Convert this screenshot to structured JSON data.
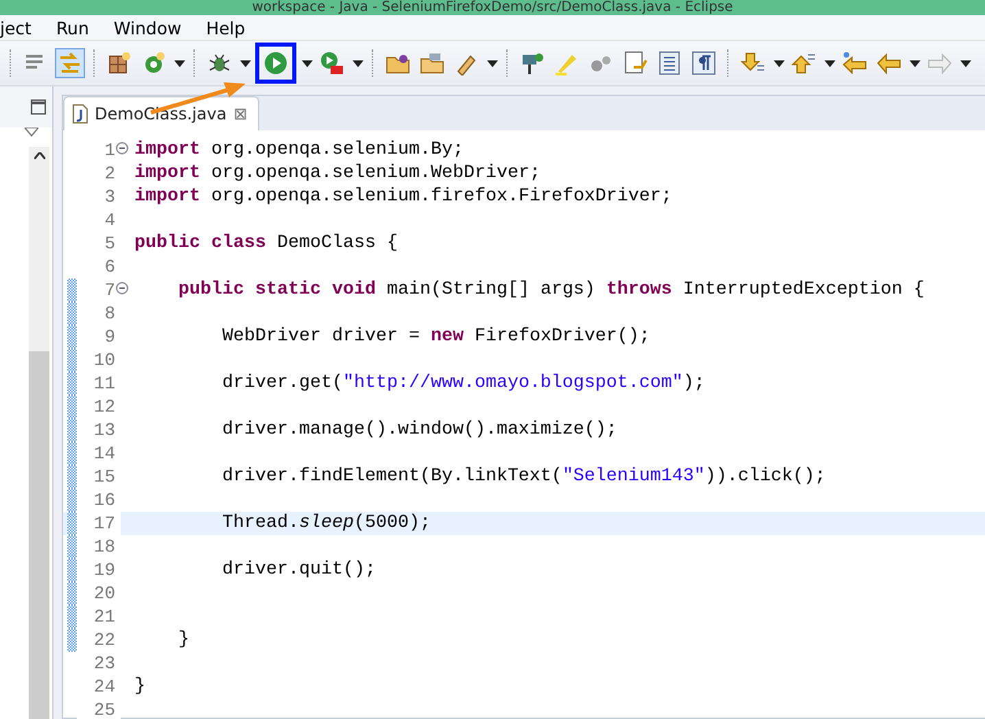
{
  "window": {
    "title": "workspace - Java - SeleniumFirefoxDemo/src/DemoClass.java - Eclipse"
  },
  "menu": [
    "ject",
    "Run",
    "Window",
    "Help"
  ],
  "toolbar": [
    {
      "kind": "sep"
    },
    {
      "kind": "lines",
      "pressed": false,
      "highlighted": false
    },
    {
      "kind": "link",
      "pressed": true,
      "highlighted": false
    },
    {
      "kind": "sep"
    },
    {
      "kind": "grid",
      "pressed": false,
      "highlighted": false
    },
    {
      "kind": "refresh",
      "pressed": false,
      "highlighted": false,
      "dropdown": true
    },
    {
      "kind": "sep"
    },
    {
      "kind": "bug",
      "pressed": false,
      "highlighted": false,
      "dropdown": true
    },
    {
      "kind": "run",
      "pressed": false,
      "highlighted": true,
      "dropdown": true
    },
    {
      "kind": "runtool",
      "pressed": false,
      "highlighted": false,
      "dropdown": true
    },
    {
      "kind": "sep"
    },
    {
      "kind": "folder",
      "pressed": false,
      "highlighted": false
    },
    {
      "kind": "openfolder",
      "pressed": false,
      "highlighted": false
    },
    {
      "kind": "pen",
      "pressed": false,
      "highlighted": false,
      "dropdown": true
    },
    {
      "kind": "sep"
    },
    {
      "kind": "search",
      "pressed": false,
      "highlighted": false
    },
    {
      "kind": "marker",
      "pressed": false,
      "highlighted": false
    },
    {
      "kind": "dots",
      "pressed": false,
      "highlighted": false
    },
    {
      "kind": "doc",
      "pressed": false,
      "highlighted": false
    },
    {
      "kind": "list",
      "pressed": false,
      "highlighted": false
    },
    {
      "kind": "para",
      "pressed": false,
      "highlighted": false
    },
    {
      "kind": "sep"
    },
    {
      "kind": "down",
      "pressed": false,
      "highlighted": false,
      "dropdown": true
    },
    {
      "kind": "up",
      "pressed": false,
      "highlighted": false,
      "dropdown": true
    },
    {
      "kind": "backstar",
      "pressed": false,
      "highlighted": false
    },
    {
      "kind": "back",
      "pressed": false,
      "highlighted": false,
      "dropdown": true
    },
    {
      "kind": "forward",
      "pressed": false,
      "highlighted": false,
      "dropdown": true
    }
  ],
  "editor": {
    "tab": {
      "label": "DemoClass.java",
      "selected": true,
      "close": "⊠"
    },
    "lines": [
      {
        "number": "1",
        "fold": true,
        "changed": false,
        "current": false,
        "tokens": [
          {
            "kind": "kw",
            "text": "import"
          },
          {
            "kind": "plain",
            "text": " org.openqa.selenium.By;"
          }
        ]
      },
      {
        "number": "2",
        "fold": false,
        "changed": false,
        "current": false,
        "tokens": [
          {
            "kind": "kw",
            "text": "import"
          },
          {
            "kind": "plain",
            "text": " org.openqa.selenium.WebDriver;"
          }
        ]
      },
      {
        "number": "3",
        "fold": false,
        "changed": false,
        "current": false,
        "tokens": [
          {
            "kind": "kw",
            "text": "import"
          },
          {
            "kind": "plain",
            "text": " org.openqa.selenium.firefox.FirefoxDriver;"
          }
        ]
      },
      {
        "number": "4",
        "fold": false,
        "changed": false,
        "current": false
      },
      {
        "number": "5",
        "fold": false,
        "changed": false,
        "current": false,
        "tokens": [
          {
            "kind": "kw",
            "text": "public class"
          },
          {
            "kind": "plain",
            "text": " DemoClass {"
          }
        ]
      },
      {
        "number": "6",
        "fold": false,
        "changed": false,
        "current": false
      },
      {
        "number": "7",
        "fold": true,
        "changed": true,
        "current": false,
        "tokens": [
          {
            "kind": "kw",
            "text": "    public static void"
          },
          {
            "kind": "plain",
            "text": " main(String[] args) "
          },
          {
            "kind": "kw",
            "text": "throws"
          },
          {
            "kind": "plain",
            "text": " InterruptedException {"
          }
        ]
      },
      {
        "number": "8",
        "fold": false,
        "changed": true,
        "current": false
      },
      {
        "number": "9",
        "fold": false,
        "changed": true,
        "current": false,
        "tokens": [
          {
            "kind": "plain",
            "text": "        WebDriver driver = "
          },
          {
            "kind": "kw",
            "text": "new"
          },
          {
            "kind": "plain",
            "text": " FirefoxDriver();"
          }
        ]
      },
      {
        "number": "10",
        "fold": false,
        "changed": true,
        "current": false
      },
      {
        "number": "11",
        "fold": false,
        "changed": true,
        "current": false,
        "tokens": [
          {
            "kind": "plain",
            "text": "        driver.get("
          },
          {
            "kind": "str",
            "text": "\"http://www.omayo.blogspot.com\""
          },
          {
            "kind": "plain",
            "text": ");"
          }
        ]
      },
      {
        "number": "12",
        "fold": false,
        "changed": true,
        "current": false
      },
      {
        "number": "13",
        "fold": false,
        "changed": true,
        "current": false,
        "tokens": [
          {
            "kind": "plain",
            "text": "        driver.manage().window().maximize();"
          }
        ]
      },
      {
        "number": "14",
        "fold": false,
        "changed": true,
        "current": false
      },
      {
        "number": "15",
        "fold": false,
        "changed": true,
        "current": false,
        "tokens": [
          {
            "kind": "plain",
            "text": "        driver.findElement(By.linkText("
          },
          {
            "kind": "str",
            "text": "\"Selenium143\""
          },
          {
            "kind": "plain",
            "text": ")).click();"
          }
        ]
      },
      {
        "number": "16",
        "fold": false,
        "changed": true,
        "current": false
      },
      {
        "number": "17",
        "fold": false,
        "changed": true,
        "current": true,
        "tokens": [
          {
            "kind": "plain",
            "text": "        Thread."
          },
          {
            "kind": "italic",
            "text": "sleep"
          },
          {
            "kind": "plain",
            "text": "(5000);"
          }
        ]
      },
      {
        "number": "18",
        "fold": false,
        "changed": true,
        "current": false
      },
      {
        "number": "19",
        "fold": false,
        "changed": true,
        "current": false,
        "tokens": [
          {
            "kind": "plain",
            "text": "        driver.quit();"
          }
        ]
      },
      {
        "number": "20",
        "fold": false,
        "changed": true,
        "current": false
      },
      {
        "number": "21",
        "fold": false,
        "changed": true,
        "current": false
      },
      {
        "number": "22",
        "fold": false,
        "changed": true,
        "current": false,
        "tokens": [
          {
            "kind": "plain",
            "text": "    }"
          }
        ]
      },
      {
        "number": "23",
        "fold": false,
        "changed": false,
        "current": false
      },
      {
        "number": "24",
        "fold": false,
        "changed": false,
        "current": false,
        "tokens": [
          {
            "kind": "plain",
            "text": "}"
          }
        ]
      },
      {
        "number": "25",
        "fold": false,
        "changed": false,
        "current": false
      }
    ]
  }
}
